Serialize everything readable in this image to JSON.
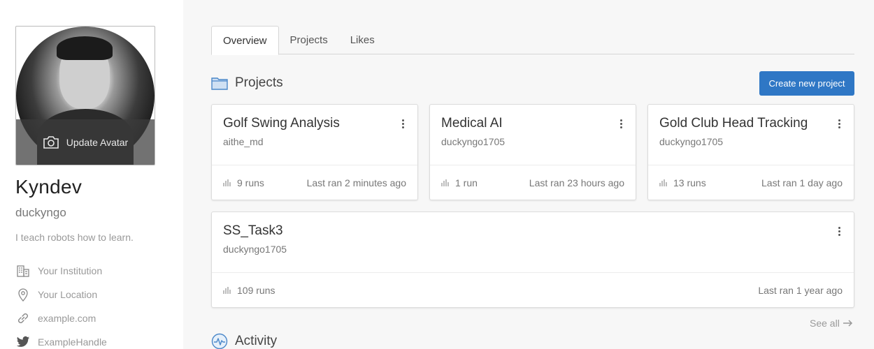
{
  "profile": {
    "display_name": "Kyndev",
    "username": "duckyngo",
    "bio": "I teach robots how to learn.",
    "avatar_overlay_label": "Update Avatar",
    "meta": [
      {
        "icon": "building-icon",
        "label": "Your Institution"
      },
      {
        "icon": "location-pin-icon",
        "label": "Your Location"
      },
      {
        "icon": "link-icon",
        "label": "example.com"
      },
      {
        "icon": "twitter-icon",
        "label": "ExampleHandle"
      }
    ]
  },
  "tabs": [
    {
      "label": "Overview",
      "active": true
    },
    {
      "label": "Projects",
      "active": false
    },
    {
      "label": "Likes",
      "active": false
    }
  ],
  "projects_section": {
    "title": "Projects",
    "icon": "folder-icon",
    "create_button_label": "Create new project",
    "see_all_label": "See all",
    "cards": [
      {
        "title": "Golf Swing Analysis",
        "owner": "aithe_md",
        "runs": "9 runs",
        "last_ran": "Last ran 2 minutes ago"
      },
      {
        "title": "Medical AI",
        "owner": "duckyngo1705",
        "runs": "1 run",
        "last_ran": "Last ran 23 hours ago"
      },
      {
        "title": "Gold Club Head Tracking",
        "owner": "duckyngo1705",
        "runs": "13 runs",
        "last_ran": "Last ran 1 day ago"
      },
      {
        "title": "SS_Task3",
        "owner": "duckyngo1705",
        "runs": "109 runs",
        "last_ran": "Last ran 1 year ago"
      }
    ]
  },
  "activity_section": {
    "title": "Activity",
    "icon": "activity-icon"
  },
  "colors": {
    "accent": "#2f77c5",
    "folder": "#4a87c9"
  }
}
